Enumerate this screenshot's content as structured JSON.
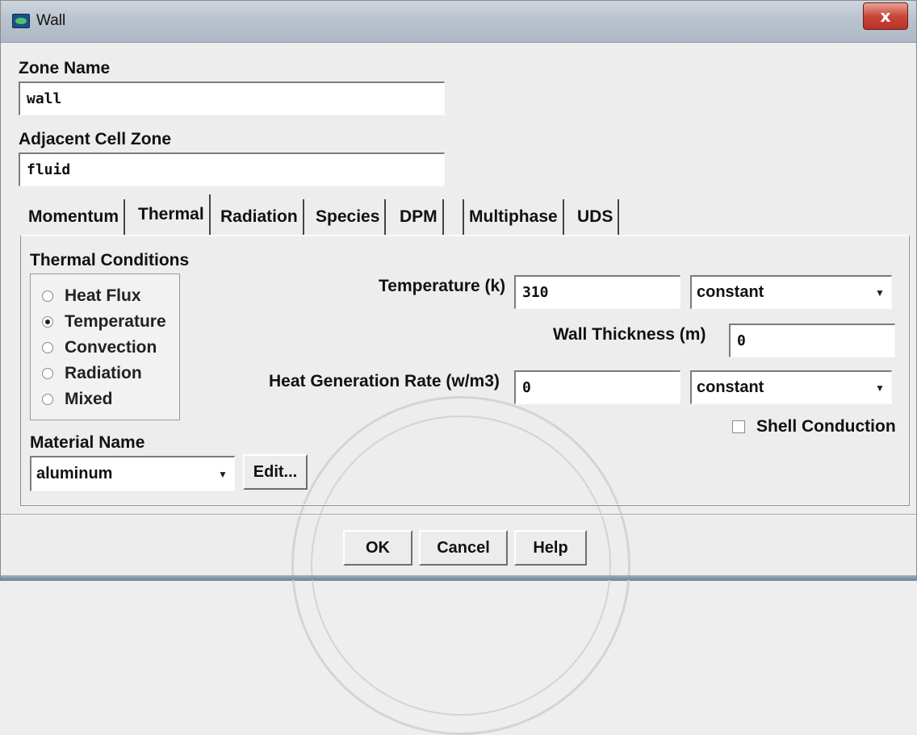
{
  "window": {
    "title": "Wall",
    "close_glyph": "x"
  },
  "zone_name": {
    "label": "Zone Name",
    "value": "wall"
  },
  "adjacent_cell_zone": {
    "label": "Adjacent Cell Zone",
    "value": "fluid"
  },
  "tabs": [
    {
      "label": "Momentum",
      "active": false
    },
    {
      "label": "Thermal",
      "active": true
    },
    {
      "label": "Radiation",
      "active": false
    },
    {
      "label": "Species",
      "active": false
    },
    {
      "label": "DPM",
      "active": false
    },
    {
      "label": "Multiphase",
      "active": false
    },
    {
      "label": "UDS",
      "active": false
    }
  ],
  "thermal": {
    "conditions_label": "Thermal Conditions",
    "options": [
      {
        "label": "Heat Flux",
        "selected": false
      },
      {
        "label": "Temperature",
        "selected": true
      },
      {
        "label": "Convection",
        "selected": false
      },
      {
        "label": "Radiation",
        "selected": false
      },
      {
        "label": "Mixed",
        "selected": false
      }
    ],
    "temperature": {
      "label": "Temperature (k)",
      "value": "310",
      "method": "constant"
    },
    "wall_thickness": {
      "label": "Wall Thickness (m)",
      "value": "0"
    },
    "heat_generation": {
      "label": "Heat Generation Rate (w/m3)",
      "value": "0",
      "method": "constant"
    },
    "shell_conduction": {
      "label": "Shell Conduction",
      "checked": false
    },
    "material": {
      "label": "Material Name",
      "value": "aluminum",
      "edit_label": "Edit..."
    }
  },
  "footer": {
    "ok_label": "OK",
    "cancel_label": "Cancel",
    "help_label": "Help"
  },
  "icons": {
    "app": "fluent-app-icon",
    "close": "close-icon",
    "dropdown": "chevron-down-icon"
  },
  "colors": {
    "title_bar": "#b9c3ce",
    "close_button": "#c9463a",
    "dialog_bg": "#ededed"
  }
}
